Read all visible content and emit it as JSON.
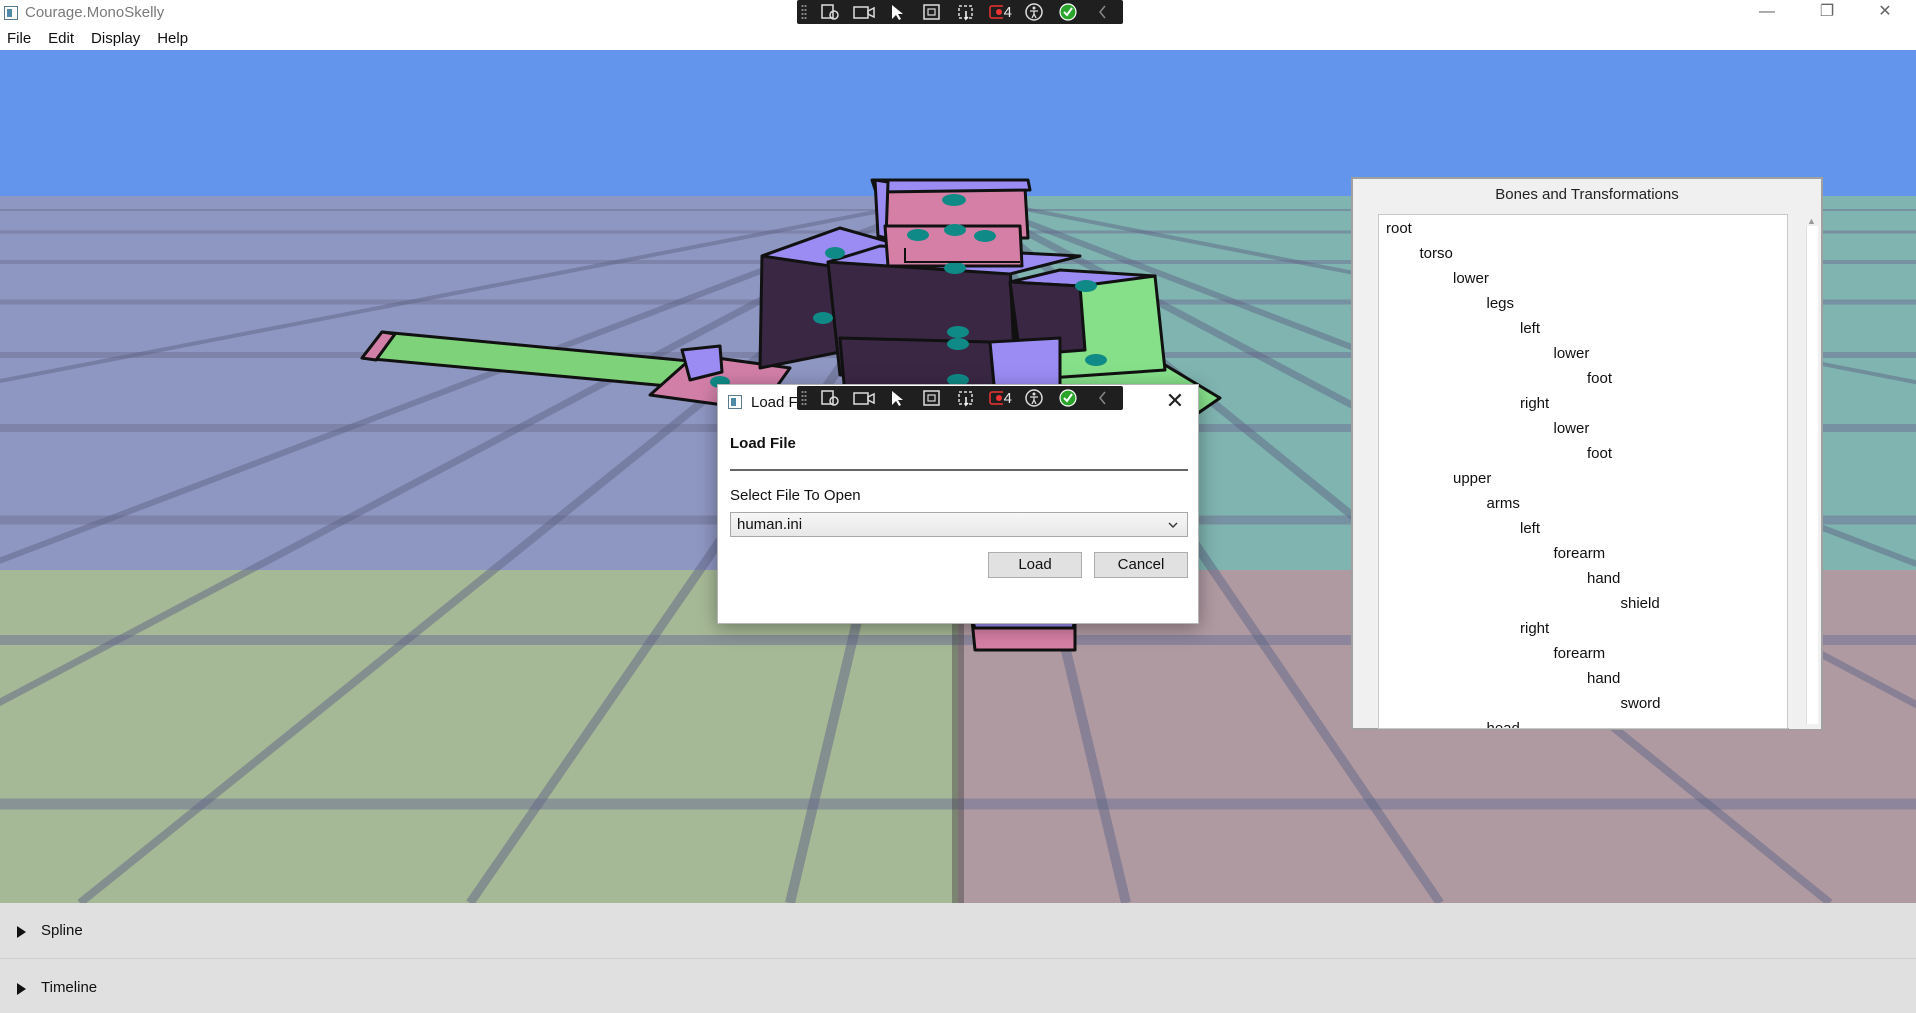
{
  "window": {
    "title": "Courage.MonoSkelly",
    "controls": {
      "minimize": "—",
      "maximize": "❐",
      "close": "✕"
    }
  },
  "debug_toolbar": {
    "live_visual_tree_count": "4",
    "icons": [
      "select-element-icon",
      "video-capture-icon",
      "select-in-app-icon",
      "display-layout-adorners-icon",
      "track-focus-icon",
      "binding-failures-icon",
      "accessibility-icon",
      "hot-reload-ok-icon",
      "collapse-toolbar-icon"
    ]
  },
  "menu": {
    "items": [
      "File",
      "Edit",
      "Display",
      "Help"
    ]
  },
  "bones_panel": {
    "title": "Bones and Transformations",
    "tree": [
      {
        "label": "root",
        "depth": 0
      },
      {
        "label": "torso",
        "depth": 1
      },
      {
        "label": "lower",
        "depth": 2
      },
      {
        "label": "legs",
        "depth": 3
      },
      {
        "label": "left",
        "depth": 4
      },
      {
        "label": "lower",
        "depth": 5
      },
      {
        "label": "foot",
        "depth": 6
      },
      {
        "label": "right",
        "depth": 4
      },
      {
        "label": "lower",
        "depth": 5
      },
      {
        "label": "foot",
        "depth": 6
      },
      {
        "label": "upper",
        "depth": 2
      },
      {
        "label": "arms",
        "depth": 3
      },
      {
        "label": "left",
        "depth": 4
      },
      {
        "label": "forearm",
        "depth": 5
      },
      {
        "label": "hand",
        "depth": 6
      },
      {
        "label": "shield",
        "depth": 7
      },
      {
        "label": "right",
        "depth": 4
      },
      {
        "label": "forearm",
        "depth": 5
      },
      {
        "label": "hand",
        "depth": 6
      },
      {
        "label": "sword",
        "depth": 7
      },
      {
        "label": "head",
        "depth": 3
      }
    ]
  },
  "dialog": {
    "title": "Load Fi",
    "heading": "Load File",
    "select_label": "Select File To Open",
    "selected_file": "human.ini",
    "load_button": "Load",
    "cancel_button": "Cancel",
    "close": "✕"
  },
  "bottom_panels": {
    "spline": "Spline",
    "timeline": "Timeline"
  },
  "colors": {
    "sky": "#6495ed",
    "quad_top_left": "#8e96c2",
    "quad_top_right": "#7fb4b0",
    "quad_bottom_left": "#a6b996",
    "quad_bottom_right": "#b09aa2",
    "accent_purple": "#9b8cf4",
    "accent_pink": "#d67fa6",
    "accent_green": "#86e08a",
    "dark_face": "#3a2744",
    "joint_teal": "#0f8a86"
  }
}
